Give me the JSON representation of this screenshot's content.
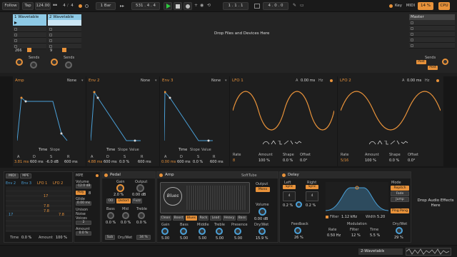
{
  "transport": {
    "follow": "Follow",
    "tap": "Tap",
    "tempo": "124.00",
    "time_sig_num": "4",
    "time_sig_den": "4",
    "quantize": "1 Bar",
    "position": "531 .  4 .  4",
    "loop_start": "1 .  1 .  1",
    "loop_length": "4 .  0 .  0",
    "key": "Key",
    "midi": "MIDI",
    "cpu_pct": "14 %",
    "cpu": "CPU"
  },
  "session": {
    "tracks": [
      {
        "name": "1 Wavetable",
        "color": "#8ecae6",
        "number": "266",
        "sends": "Sends",
        "send_a": "A",
        "send_b": "B"
      },
      {
        "name": "2 Wavetable",
        "color": "#8ecae6",
        "number": "9",
        "sends": "Sends",
        "send_a": "A",
        "send_b": "B"
      }
    ],
    "drop_text": "Drop Files and Devices Here",
    "master": {
      "name": "Master",
      "sends": "Sends",
      "post1": "Post",
      "post2": "Post"
    }
  },
  "envelopes": [
    {
      "title": "Amp",
      "mode": "None",
      "a_label": "A",
      "d_label": "D",
      "s_label": "S",
      "r_label": "R",
      "a": "3.81 ms",
      "d": "600 ms",
      "s": "-6.0 dB",
      "r": "600 ms",
      "footer_a": "Time",
      "footer_b": "Slope"
    },
    {
      "title": "Env 2",
      "mode": "None",
      "a_label": "A",
      "d_label": "D",
      "s_label": "S",
      "r_label": "R",
      "a": "4.88 ms",
      "d": "600 ms",
      "s": "0.0 %",
      "r": "600 ms",
      "footer_a": "Time",
      "footer_b": "Slope",
      "footer_c": "Value"
    },
    {
      "title": "Env 3",
      "mode": "None",
      "a_label": "A",
      "d_label": "D",
      "s_label": "S",
      "r_label": "R",
      "a": "0.00 ms",
      "d": "600 ms",
      "s": "0.0 %",
      "r": "600 ms",
      "footer_a": "Time",
      "footer_b": "Slope",
      "footer_c": "Value"
    }
  ],
  "lfos": [
    {
      "title": "LFO 1",
      "a": "A",
      "a_val": "0.00 ms",
      "unit": "Hz",
      "rate_label": "Rate",
      "amount_label": "Amount",
      "shape_label": "Shape",
      "offset_label": "Offset",
      "rate": "8",
      "amount": "100 %",
      "shape": "0.0 %",
      "offset": "0.0°"
    },
    {
      "title": "LFO 2",
      "a": "A",
      "a_val": "0.00 ms",
      "unit": "Hz",
      "rate_label": "Rate",
      "amount_label": "Amount",
      "shape_label": "Shape",
      "offset_label": "Offset",
      "rate": "5/16",
      "amount": "100 %",
      "shape": "0.0 %",
      "offset": "0.0°"
    }
  ],
  "mod_matrix": {
    "tab_midi": "MIDI",
    "tab_mpe": "MPE",
    "cols": [
      "Env 2",
      "Env 3",
      "LFO 1",
      "LFO 2"
    ],
    "row_vals": [
      "17",
      "7.8",
      "7.8",
      "17",
      "7.8"
    ],
    "time": "Time",
    "time_val": "0.0 %",
    "amount": "Amount",
    "amount_val": "100 %"
  },
  "voice_panel": {
    "mpe": "MPE",
    "volume": "Volume",
    "volume_val": "-12.0 dB",
    "poly": "Poly",
    "poly_val": "8",
    "glide": "Glide",
    "glide_val": "0.00 ms",
    "unison": "Unison",
    "unison_val": "Noise",
    "voices": "Voices",
    "voices_val": "2",
    "amount": "Amount",
    "amount_val": "0.0 %"
  },
  "pedal": {
    "title": "Pedal",
    "gain": "Gain",
    "gain_val": "2.0 %",
    "output": "Output",
    "output_val": "0.00 dB",
    "types": [
      "OD",
      "Distort",
      "Fuzz"
    ],
    "bass": "Bass",
    "mid": "Mid",
    "treble": "Treble",
    "bass_val": "0.0 %",
    "mid_val": "0.0 %",
    "treble_val": "0.0 %",
    "sub": "Sub",
    "drywet": "Dry/Wet",
    "drywet_val": "34 %"
  },
  "amp": {
    "title": "Amp",
    "brand": "SoftTube",
    "logo": "Blues",
    "output": "Output",
    "mono": "Mono",
    "volume": "Volume",
    "volume_val": "0.00 dB",
    "types": [
      "Clean",
      "Boost",
      "Blues",
      "Rock",
      "Lead",
      "Heavy",
      "Bass"
    ],
    "knobs": [
      "Gain",
      "Bass",
      "Middle",
      "Treble",
      "Presence"
    ],
    "knob_vals": [
      "5.00",
      "5.00",
      "5.00",
      "5.00",
      "5.00"
    ],
    "drywet": "Dry/Wet",
    "drywet_val": "15.9 %"
  },
  "delay": {
    "title": "Delay",
    "left": "Left",
    "right": "Right",
    "sync": "Sync",
    "left_val": "4",
    "right_val": "4",
    "left_off": "0.2 %",
    "right_off": "0.2 %",
    "feedback": "Feedback",
    "feedback_val": "26 %",
    "filter": "Filter",
    "filter_freq": "1.12 kHz",
    "width": "Width",
    "width_val": "5.20",
    "modulation": "Modulation",
    "rate": "Rate",
    "rate_val": "0.50 Hz",
    "filter2": "Filter",
    "filter2_val": "12 %",
    "time": "Time",
    "time_val": "5.5 %",
    "mode": "Mode",
    "modes": [
      "Repitch",
      "Fade",
      "Jump"
    ],
    "pingpong": "Ping Pong",
    "drywet": "Dry/Wet",
    "drywet_val": "29 %"
  },
  "drop_audio": "Drop Audio Effects Here",
  "statusbar": {
    "track": "2-Wavetable"
  },
  "colors": {
    "accent": "#e8923a",
    "blue": "#4aa0d8",
    "track": "#8ecae6",
    "play": "#2ecc40"
  }
}
